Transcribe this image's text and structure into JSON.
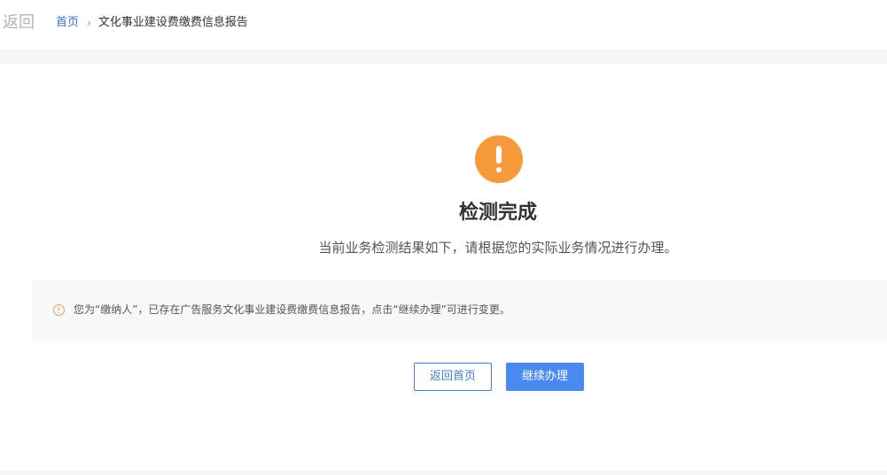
{
  "header": {
    "back_label": "返回",
    "breadcrumb": {
      "home": "首页",
      "separator": "›",
      "current": "文化事业建设费缴费信息报告"
    }
  },
  "result": {
    "icon": "warning-icon",
    "title": "检测完成",
    "subtitle": "当前业务检测结果如下，请根据您的实际业务情况进行办理。"
  },
  "notice": {
    "icon": "info-warning-icon",
    "text": "您为“缴纳人”，已存在广告服务文化事业建设费缴费信息报告，点击“继续办理”可进行变更。"
  },
  "actions": {
    "home_label": "返回首页",
    "continue_label": "继续办理"
  },
  "colors": {
    "accent": "#4a8af0",
    "warning": "#f79a3b",
    "link": "#3b73c4"
  }
}
